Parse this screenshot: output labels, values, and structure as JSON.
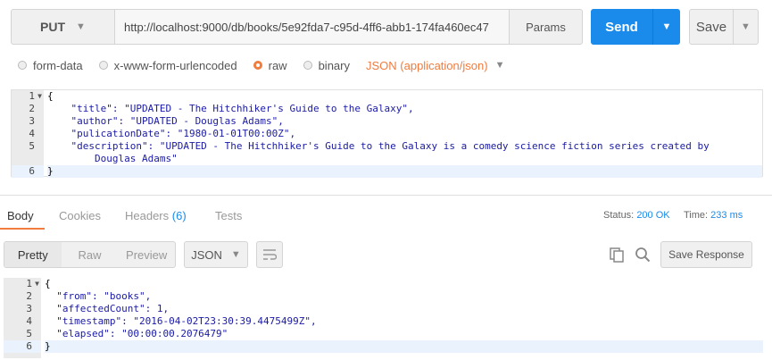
{
  "request": {
    "method": "PUT",
    "url": "http://localhost:9000/db/books/5e92fda7-c95d-4ff6-abb1-174fa460ec47",
    "params_label": "Params",
    "send_label": "Send",
    "save_label": "Save"
  },
  "body_types": {
    "options": [
      "form-data",
      "x-www-form-urlencoded",
      "raw",
      "binary"
    ],
    "selected": "raw",
    "content_type": "JSON (application/json)"
  },
  "request_body": {
    "line_numbers": [
      "1",
      "2",
      "3",
      "4",
      "5",
      "",
      "6"
    ],
    "lines": [
      "{",
      "    \"title\": \"UPDATED - The Hitchhiker's Guide to the Galaxy\",",
      "    \"author\": \"UPDATED - Douglas Adams\",",
      "    \"pulicationDate\": \"1980-01-01T00:00Z\",",
      "    \"description\": \"UPDATED - The Hitchhiker's Guide to the Galaxy is a comedy science fiction series created by",
      "        Douglas Adams\"",
      "}"
    ]
  },
  "response_tabs": {
    "body": "Body",
    "cookies": "Cookies",
    "headers": "Headers",
    "headers_count": "(6)",
    "tests": "Tests"
  },
  "status": {
    "status_label": "Status:",
    "status_value": "200 OK",
    "time_label": "Time:",
    "time_value": "233 ms"
  },
  "response_toolbar": {
    "views": [
      "Pretty",
      "Raw",
      "Preview"
    ],
    "format": "JSON",
    "save_response_label": "Save Response"
  },
  "response_body": {
    "line_numbers": [
      "1",
      "2",
      "3",
      "4",
      "5",
      "6"
    ],
    "lines": [
      "{",
      "  \"from\": \"books\",",
      "  \"affectedCount\": 1,",
      "  \"timestamp\": \"2016-04-02T23:30:39.4475499Z\",",
      "  \"elapsed\": \"00:00:00.2076479\"",
      "}"
    ]
  }
}
